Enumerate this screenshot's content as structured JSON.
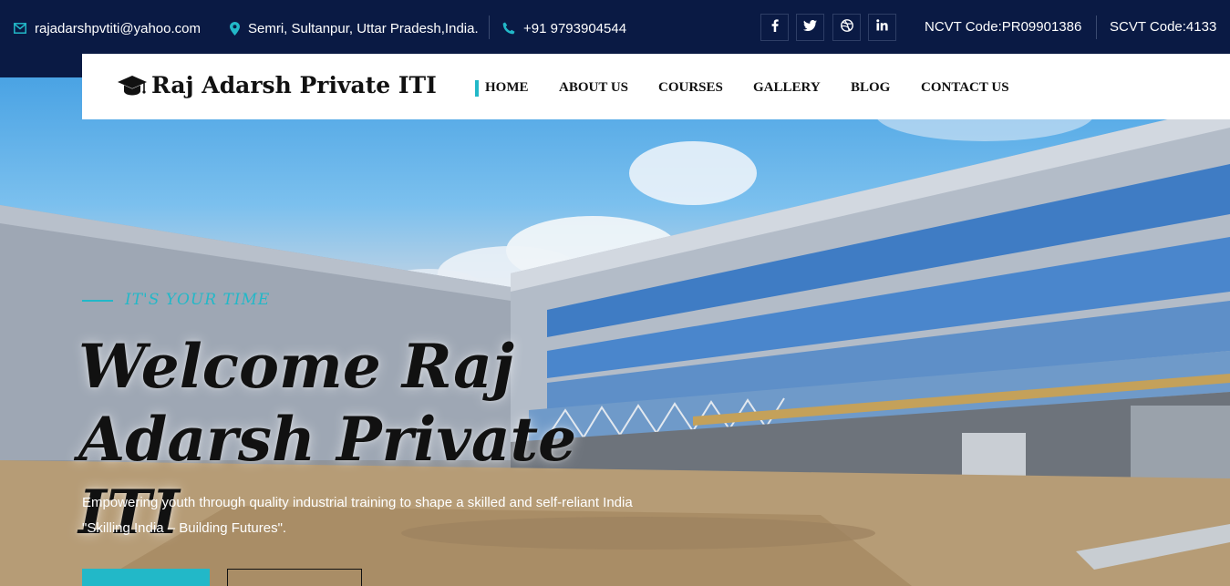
{
  "topbar": {
    "email": "rajadarshpvtiti@yahoo.com",
    "address": "Semri, Sultanpur, Uttar Pradesh,India.",
    "phone": "+91 9793904544",
    "ncvt": "NCVT Code:PR09901386",
    "scvt": "SCVT Code:4133",
    "social_icons": [
      "facebook-icon",
      "twitter-icon",
      "dribbble-icon",
      "linkedin-icon"
    ]
  },
  "brand": {
    "name": "Raj Adarsh Private ITI",
    "icon": "graduation-cap-icon"
  },
  "nav": {
    "items": [
      "HOME",
      "ABOUT US",
      "COURSES",
      "GALLERY",
      "BLOG",
      "CONTACT US"
    ],
    "active": "HOME"
  },
  "hero": {
    "tagline": "IT'S YOUR TIME",
    "headline_line1": "Welcome Raj",
    "headline_line2": "Adarsh Private ITI",
    "description": "Empowering youth through quality industrial training to shape a skilled and self-reliant India \"Skilling India – Building Futures\"."
  },
  "colors": {
    "topbar_bg": "#0a1a44",
    "accent": "#22b8c8",
    "nav_bg": "#ffffff"
  }
}
